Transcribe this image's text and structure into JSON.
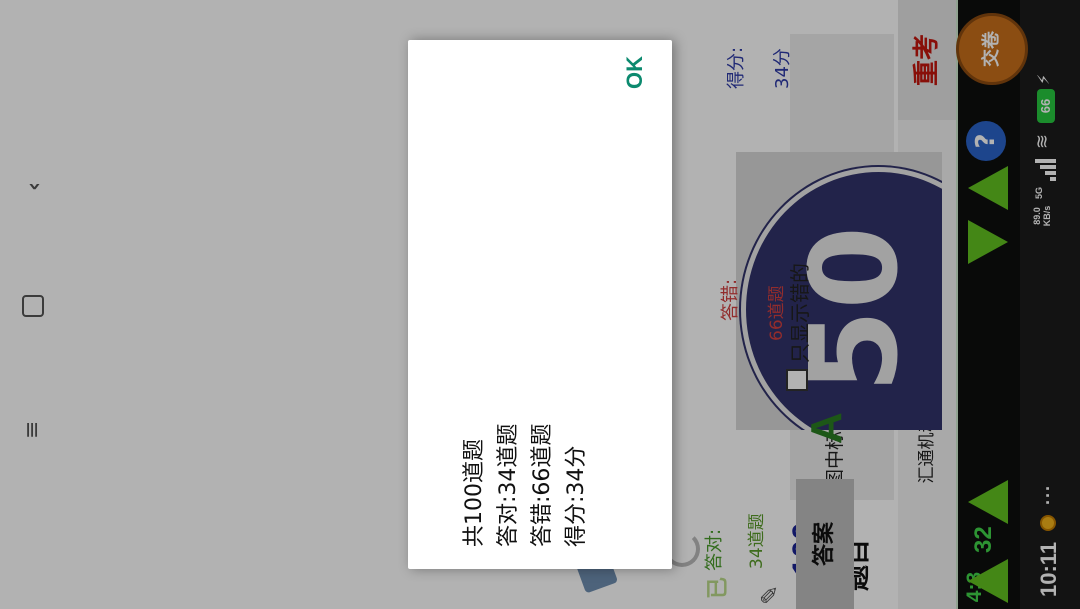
{
  "status": {
    "time": "10:11",
    "net_speed": "89.0\nKB/s",
    "net_type": "5G",
    "battery": "66"
  },
  "timer": {
    "minutes": "4:3",
    "seconds": "32"
  },
  "title": {
    "app_name": "汇通机动车驾驶员法培考试软件",
    "retake_label": "重考"
  },
  "question": {
    "label": "题目",
    "number": "100",
    "text": "图中标志为最低限速标志。",
    "sign_number": "50"
  },
  "answer": {
    "option_label": "A",
    "show_wrong_only": "只显示错的",
    "answer_button": "答案"
  },
  "scores": {
    "correct_label": "答对:",
    "correct_value": "34道题",
    "wrong_label": "答错:",
    "wrong_value": "66道题",
    "score_label": "得分:",
    "score_value": "34分"
  },
  "tools": {
    "help_label": "?",
    "hand_in_label": "交卷"
  },
  "dialog": {
    "lines": [
      "共100道题",
      "答对:34道题",
      "答错:66道题",
      "得分:34分"
    ],
    "ok_label": "OK"
  },
  "colors": {
    "timer": "#41d54a",
    "retake": "#c3160d",
    "ok": "#0c8a6f",
    "score": "#2f3ba8"
  }
}
